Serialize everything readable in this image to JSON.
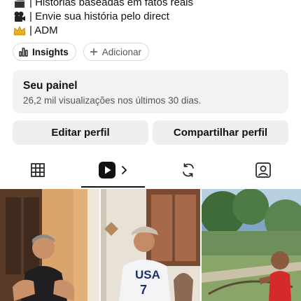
{
  "bio": {
    "lines": [
      {
        "emoji": "clapper-icon",
        "text": "| Histórias baseadas em fatos reais"
      },
      {
        "emoji": "camera-icon",
        "text": "| Envie sua história pelo direct"
      },
      {
        "emoji": "crown-icon",
        "text": "| ADM"
      }
    ]
  },
  "chips": {
    "insights_label": "Insights",
    "add_label": "Adicionar"
  },
  "panel": {
    "title": "Seu painel",
    "subtitle": "26,2 mil visualizações nos últimos 30 dias."
  },
  "actions": {
    "edit_label": "Editar perfil",
    "share_label": "Compartilhar perfil"
  },
  "tabs": {
    "items": [
      "grid-icon",
      "reels-icon",
      "reposts-icon",
      "tagged-icon"
    ],
    "active": "reels-icon"
  },
  "grid": {
    "thumbnails": [
      {
        "shirt_text": ""
      },
      {
        "shirt_text": "USA",
        "shirt_number": "7"
      },
      {
        "shirt_text": ""
      }
    ]
  },
  "colors": {
    "panel_bg": "#f1f2f4",
    "button_bg": "#efeff1",
    "text_primary": "#111111",
    "text_secondary": "#555555"
  }
}
